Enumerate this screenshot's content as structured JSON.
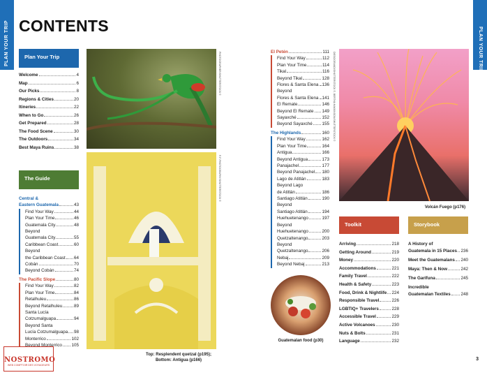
{
  "side_tab_left": "PLAN YOUR TRIP",
  "side_tab_right": "PLAN YOUR TRIP",
  "title": "CONTENTS",
  "plan_your_trip": {
    "header": "Plan Your Trip",
    "items": [
      {
        "label": "Welcome",
        "page": "4"
      },
      {
        "label": "Map",
        "page": "6"
      },
      {
        "label": "Our Picks",
        "page": "8"
      },
      {
        "label": "Regions & Cities",
        "page": "20"
      },
      {
        "label": "Itineries",
        "page": "22"
      },
      {
        "label": "When to Go",
        "page": "26"
      },
      {
        "label": "Get Prepared",
        "page": "28"
      },
      {
        "label": "The Food Scene",
        "page": "30"
      },
      {
        "label": "The Outdoors",
        "page": "34"
      },
      {
        "label": "Best Maya Ruins",
        "page": "38"
      }
    ]
  },
  "the_guide": {
    "header": "The Guide",
    "central": {
      "title_line1": "Central &",
      "title_line2": "Eastern Guatemala",
      "page": "43",
      "items": [
        {
          "label": "Find Your Way",
          "page": "44"
        },
        {
          "label": "Plan Your Time",
          "page": "46"
        },
        {
          "label": "Guatemala City",
          "page": "48"
        },
        {
          "label": "Beyond",
          "page": ""
        },
        {
          "label": "Guatemala City",
          "page": "55"
        },
        {
          "label": "Caribbean Coast",
          "page": "60"
        },
        {
          "label": "Beyond",
          "page": ""
        },
        {
          "label": "the Caribbean Coast",
          "page": "64"
        },
        {
          "label": "Cobán",
          "page": "70"
        },
        {
          "label": "Beyond Cobán",
          "page": "74"
        }
      ]
    },
    "pacific": {
      "title": "The Pacific Slope",
      "page": "80",
      "items": [
        {
          "label": "Find Your Way",
          "page": "82"
        },
        {
          "label": "Plan Your Time",
          "page": "84"
        },
        {
          "label": "Retalhuleu",
          "page": "86"
        },
        {
          "label": "Beyond Retalhuleu",
          "page": "89"
        },
        {
          "label": "Santa Lucía",
          "page": ""
        },
        {
          "label": "Cotzumalguapa",
          "page": "94"
        },
        {
          "label": "Beyond Santa",
          "page": ""
        },
        {
          "label": "Lucía Cotzumalguapa",
          "page": "98"
        },
        {
          "label": "Monterrico",
          "page": "102"
        },
        {
          "label": "Beyond Monterrico",
          "page": "105"
        }
      ]
    }
  },
  "middle": {
    "peten": {
      "title": "El Petén",
      "page": "111",
      "items": [
        {
          "label": "Find Your Way",
          "page": "112"
        },
        {
          "label": "Plan Your Time",
          "page": "114"
        },
        {
          "label": "Tikal",
          "page": "116"
        },
        {
          "label": "Beyond Tikal",
          "page": "128"
        },
        {
          "label": "Flores & Santa Elena",
          "page": "136"
        },
        {
          "label": "Beyond",
          "page": ""
        },
        {
          "label": "Flores & Santa Elena",
          "page": "141"
        },
        {
          "label": "El Remate",
          "page": "146"
        },
        {
          "label": "Beyond El Remate",
          "page": "149"
        },
        {
          "label": "Sayaxché",
          "page": "152"
        },
        {
          "label": "Beyond Sayaxché",
          "page": "155"
        }
      ]
    },
    "highlands": {
      "title": "The Highlands",
      "page": "160",
      "items": [
        {
          "label": "Find Your Way",
          "page": "162"
        },
        {
          "label": "Plan Your Time",
          "page": "164"
        },
        {
          "label": "Antigua",
          "page": "166"
        },
        {
          "label": "Beyond Antigua",
          "page": "173"
        },
        {
          "label": "Panajachel",
          "page": "177"
        },
        {
          "label": "Beyond Panajachel",
          "page": "180"
        },
        {
          "label": "Lago de Atitlán",
          "page": "183"
        },
        {
          "label": "Beyond Lago",
          "page": ""
        },
        {
          "label": "de Atitlán",
          "page": "186"
        },
        {
          "label": "Santiago Atitlán",
          "page": "190"
        },
        {
          "label": "Beyond",
          "page": ""
        },
        {
          "label": "Santiago Atitlán",
          "page": "194"
        },
        {
          "label": "Huehuetenango",
          "page": "197"
        },
        {
          "label": "Beyond",
          "page": ""
        },
        {
          "label": "Huehuetenango",
          "page": "200"
        },
        {
          "label": "Quetzaltenango",
          "page": "203"
        },
        {
          "label": "Beyond",
          "page": ""
        },
        {
          "label": "Quetzaltenango",
          "page": "206"
        },
        {
          "label": "Nebaj",
          "page": "209"
        },
        {
          "label": "Beyond Nebaj",
          "page": "213"
        }
      ]
    }
  },
  "toolkit": {
    "header": "Toolkit",
    "items": [
      {
        "label": "Arriving",
        "page": "218"
      },
      {
        "label": "Getting Around",
        "page": "219"
      },
      {
        "label": "Money",
        "page": "220"
      },
      {
        "label": "Accommodations",
        "page": "221"
      },
      {
        "label": "Family Travel",
        "page": "222"
      },
      {
        "label": "Health & Safety",
        "page": "223"
      },
      {
        "label": "Food, Drink & Nightlife",
        "page": "224"
      },
      {
        "label": "Responsible Travel",
        "page": "226"
      },
      {
        "label": "LGBTIQ+ Travelers",
        "page": "228"
      },
      {
        "label": "Accessible Travel",
        "page": "229"
      },
      {
        "label": "Active Volcanoes",
        "page": "230"
      },
      {
        "label": "Nuts & Bolts",
        "page": "231"
      },
      {
        "label": "Language",
        "page": "232"
      }
    ]
  },
  "storybook": {
    "header": "Storybook",
    "items": [
      {
        "label_line1": "A History of",
        "label_line2": "Guatemala in 15 Places",
        "page": "236"
      },
      {
        "label_line1": "",
        "label_line2": "Meet the Guatemalans",
        "page": "240"
      },
      {
        "label_line1": "",
        "label_line2": "Maya: Then & Now",
        "page": "242"
      },
      {
        "label_line1": "",
        "label_line2": "The Garífuna",
        "page": "245"
      },
      {
        "label_line1": "Incredible",
        "label_line2": "Guatemalan Textiles",
        "page": "248"
      }
    ]
  },
  "captions": {
    "left_photos": "Top: Resplendent quetzal (p195);\nBottom: Antigua (p166)",
    "volcano": "Volcán Fuego (p176)",
    "food": "Guatemalan food (p30)"
  },
  "credits": {
    "quetzal": "PHOTOGRAPHER/SHUTTERSTOCK ©",
    "antigua": "F-F-PHOTOGRAPHY/SHUTTERSTOCK ©",
    "volcano": "DIEGOGRANDI/SHUTTERSTOCK ©, BERTHA HAKKINSON/SHUTTERSTOCK ©"
  },
  "page_number": "3",
  "logo": {
    "name": "NOSTROMO",
    "tagline": "WEB COMPTOIR DES VOYAGEURS"
  }
}
